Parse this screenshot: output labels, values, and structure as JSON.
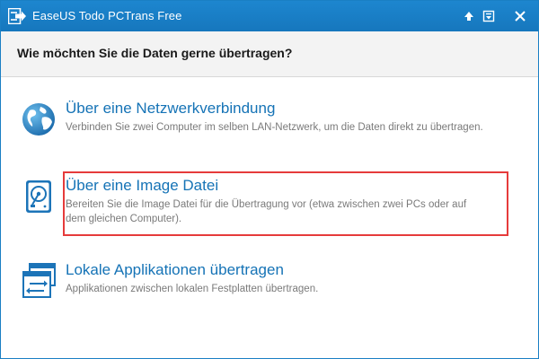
{
  "window": {
    "title": "EaseUS Todo PCTrans Free",
    "controls": [
      "help-arrow",
      "minimize",
      "close"
    ]
  },
  "header": {
    "question": "Wie möchten Sie die Daten gerne übertragen?"
  },
  "options": [
    {
      "id": "network",
      "icon": "globe-icon",
      "title": "Über eine Netzwerkverbindung",
      "description": "Verbinden Sie zwei Computer im selben LAN-Netzwerk, um die Daten direkt zu übertragen."
    },
    {
      "id": "image",
      "icon": "hard-drive-icon",
      "title": "Über eine Image Datei",
      "description": "Bereiten Sie die Image Datei für die Übertragung vor (etwa zwischen zwei PCs oder auf dem gleichen Computer).",
      "highlighted": true
    },
    {
      "id": "local-apps",
      "icon": "transfer-windows-icon",
      "title": "Lokale Applikationen übertragen",
      "description": "Applikationen zwischen lokalen Festplatten übertragen."
    }
  ],
  "colors": {
    "titlebar": "#1a7fc4",
    "accent": "#1573b6",
    "highlight": "#e63b3b"
  }
}
